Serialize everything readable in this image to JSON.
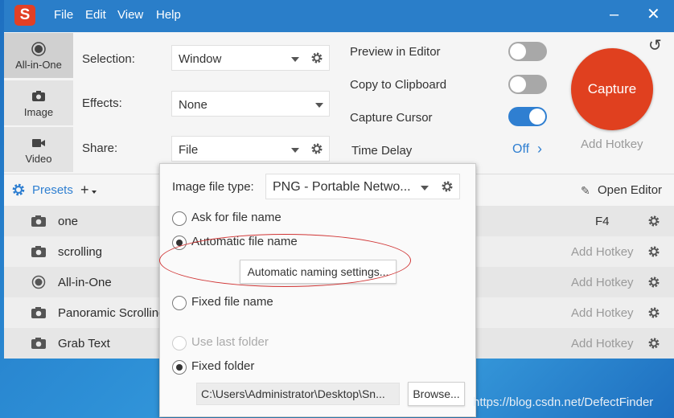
{
  "menu": {
    "file": "File",
    "edit": "Edit",
    "view": "View",
    "help": "Help"
  },
  "tabs": [
    {
      "label": "All-in-One",
      "icon": "record-icon"
    },
    {
      "label": "Image",
      "icon": "camera-icon"
    },
    {
      "label": "Video",
      "icon": "video-icon"
    }
  ],
  "settings": {
    "selection_label": "Selection:",
    "selection_value": "Window",
    "effects_label": "Effects:",
    "effects_value": "None",
    "share_label": "Share:",
    "share_value": "File"
  },
  "options": {
    "preview_label": "Preview in Editor",
    "preview_on": false,
    "clipboard_label": "Copy to Clipboard",
    "clipboard_on": false,
    "cursor_label": "Capture Cursor",
    "cursor_on": true,
    "delay_label": "Time Delay",
    "delay_value": "Off"
  },
  "capture": {
    "label": "Capture",
    "hotkey": "Add Hotkey",
    "color": "#e0401f"
  },
  "presets": {
    "label": "Presets",
    "add": "+",
    "open_editor": "Open Editor",
    "items": [
      {
        "name": "one",
        "icon": "camera-icon",
        "hotkey": "F4"
      },
      {
        "name": "scrolling",
        "icon": "camera-icon",
        "hotkey": "Add Hotkey"
      },
      {
        "name": "All-in-One",
        "icon": "record-icon",
        "hotkey": "Add Hotkey"
      },
      {
        "name": "Panoramic Scrolling",
        "icon": "camera-icon",
        "hotkey": "Add Hotkey"
      },
      {
        "name": "Grab Text",
        "icon": "camera-icon",
        "hotkey": "Add Hotkey"
      }
    ]
  },
  "popup": {
    "file_type_label": "Image file type:",
    "file_type_value": "PNG - Portable Netwo...",
    "ask_name": "Ask for file name",
    "auto_name": "Automatic file name",
    "auto_settings": "Automatic naming settings...",
    "fixed_name": "Fixed file name",
    "last_folder": "Use last folder",
    "fixed_folder": "Fixed folder",
    "folder_path": "C:\\Users\\Administrator\\Desktop\\Sn...",
    "browse": "Browse..."
  },
  "watermark": "https://blog.csdn.net/DefectFinder"
}
